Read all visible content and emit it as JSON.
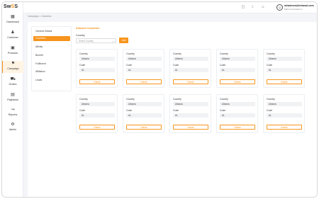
{
  "app": {
    "logo_part1": "Sw",
    "logo_part2": "S",
    "logo_part3": "S"
  },
  "sidebar": {
    "items": [
      {
        "label": "Dashboard",
        "icon": "grid-icon"
      },
      {
        "label": "Customer",
        "icon": "user-icon"
      },
      {
        "label": "Products",
        "icon": "box-icon"
      },
      {
        "label": "Campaign",
        "icon": "flag-icon"
      },
      {
        "label": "Orders",
        "icon": "truck-icon"
      },
      {
        "label": "Paybacks",
        "icon": "wallet-icon"
      },
      {
        "label": "Reports",
        "icon": "chart-icon"
      },
      {
        "label": "Admin",
        "icon": "gear-icon"
      }
    ]
  },
  "topbar": {
    "user_email": "mhashem@mtrasol.com",
    "user_name": "Mahmoud Hashem"
  },
  "breadcrumb": "Campaign > Overview",
  "subnav": {
    "items": [
      "General Details",
      "Countries",
      "Affinity",
      "Benefit",
      "Fulfilment",
      "Affiliation",
      "Leads"
    ]
  },
  "main": {
    "section_title": "Allowed Countries",
    "country_label": "Country",
    "country_placeholder": "Select Country",
    "add_label": "Add"
  },
  "cards": [
    {
      "country_label": "Country",
      "country": "Albania",
      "code_label": "Code",
      "code": "AL",
      "delete_label": "Delete"
    },
    {
      "country_label": "Country",
      "country": "Albania",
      "code_label": "Code",
      "code": "AL",
      "delete_label": "Delete"
    },
    {
      "country_label": "Country",
      "country": "Albania",
      "code_label": "Code",
      "code": "AL",
      "delete_label": "Delete"
    },
    {
      "country_label": "Country",
      "country": "Albania",
      "code_label": "Code",
      "code": "AL",
      "delete_label": "Delete"
    },
    {
      "country_label": "Country",
      "country": "Albania",
      "code_label": "Code",
      "code": "AL",
      "delete_label": "Delete"
    },
    {
      "country_label": "Country",
      "country": "Albania",
      "code_label": "Code",
      "code": "AL",
      "delete_label": "Delete"
    },
    {
      "country_label": "Country",
      "country": "Albania",
      "code_label": "Code",
      "code": "AL",
      "delete_label": "Delete"
    },
    {
      "country_label": "Country",
      "country": "Albania",
      "code_label": "Code",
      "code": "AL",
      "delete_label": "Delete"
    },
    {
      "country_label": "Country",
      "country": "Albania",
      "code_label": "Code",
      "code": "AL",
      "delete_label": "Delete"
    },
    {
      "country_label": "Country",
      "country": "Albania",
      "code_label": "Code",
      "code": "AL",
      "delete_label": "Delete"
    }
  ],
  "colors": {
    "accent": "#f7941d",
    "background": "#f4f5f9"
  }
}
